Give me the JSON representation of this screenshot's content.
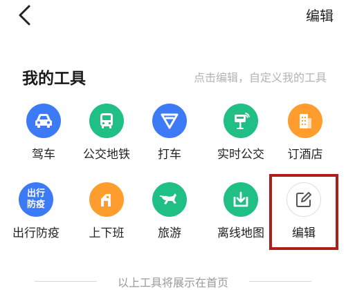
{
  "topbar": {
    "back_icon": "chevron-left-icon",
    "edit_label": "编辑"
  },
  "section": {
    "title": "我的工具",
    "hint": "点击编辑，自定义我的工具"
  },
  "tools": [
    {
      "label": "驾车",
      "icon": "car-icon",
      "color": "#3d7bf6"
    },
    {
      "label": "公交地铁",
      "icon": "bus-icon",
      "color": "#1fbf86"
    },
    {
      "label": "打车",
      "icon": "taxi-icon",
      "color": "#3d7bf6"
    },
    {
      "label": "实时公交",
      "icon": "bus-stop-icon",
      "color": "#1fbf86"
    },
    {
      "label": "订酒店",
      "icon": "hotel-icon",
      "color": "#ff9d2e"
    },
    {
      "label": "出行防疫",
      "icon": "epidemic-prevention-icon",
      "color": "#3d7bf6",
      "icon_text_1": "出行",
      "icon_text_2": "防疫"
    },
    {
      "label": "上下班",
      "icon": "commute-icon",
      "color": "#ff9d2e"
    },
    {
      "label": "旅游",
      "icon": "horse-icon",
      "color": "#1fbf86"
    },
    {
      "label": "离线地图",
      "icon": "download-icon",
      "color": "#1fbf86"
    },
    {
      "label": "编辑",
      "icon": "edit-icon",
      "color": "#555555"
    }
  ],
  "footer": {
    "text": "以上工具将展示在首页"
  }
}
